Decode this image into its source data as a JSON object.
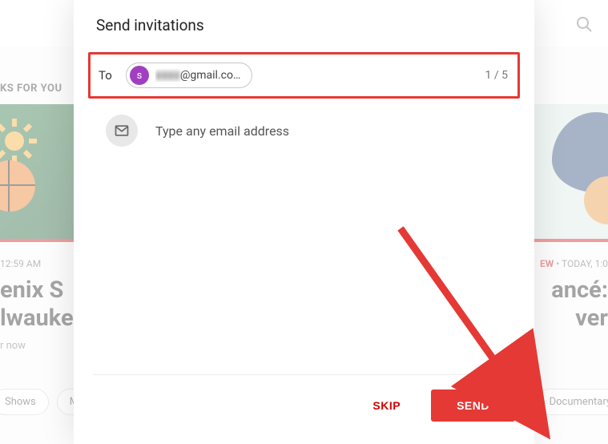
{
  "background": {
    "section_label": "KS FOR YOU",
    "left_tile": {
      "meta": "12:59 AM",
      "title": "enix S\nlwaukee",
      "subtitle": "r now"
    },
    "right_tile": {
      "new_label": "EW",
      "meta": " • TODAY, 1:0",
      "title": "ancé:\nver"
    },
    "chips": {
      "shows": "Shows",
      "movies": "Mov",
      "documentary": "Documentary"
    }
  },
  "modal": {
    "title": "Send invitations",
    "to_label": "To",
    "chip": {
      "avatar_letter": "s",
      "obscured": "▮▮▮▮",
      "email_suffix": "@gmail.co…"
    },
    "counter": "1 / 5",
    "hint": "Type any email address",
    "skip_label": "SKIP",
    "send_label": "SEND"
  }
}
